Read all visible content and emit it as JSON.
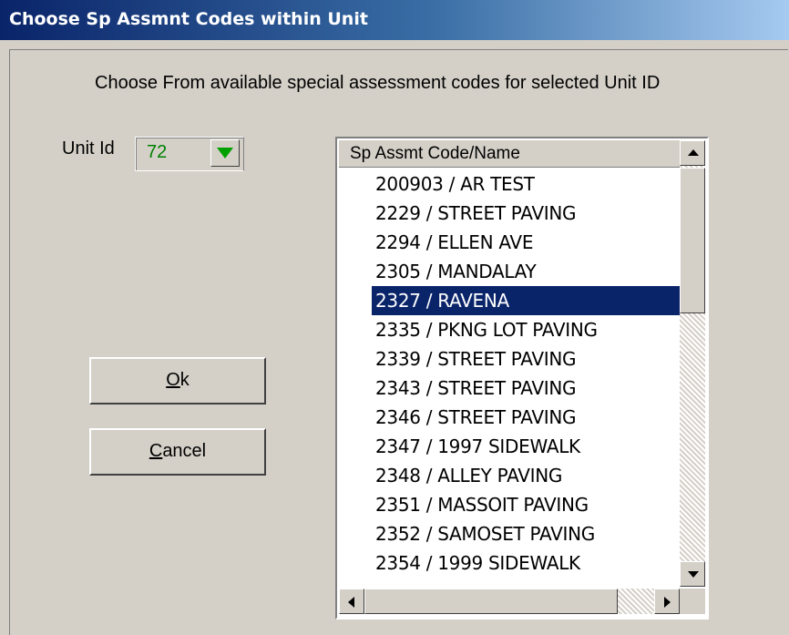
{
  "window": {
    "title": "Choose Sp Assmnt Codes within Unit"
  },
  "instruction": "Choose From available special assessment codes for selected Unit ID",
  "unit": {
    "label": "Unit Id",
    "value": "72"
  },
  "buttons": {
    "ok": {
      "mnemonic": "O",
      "rest": "k"
    },
    "cancel": {
      "mnemonic": "C",
      "rest": "ancel"
    }
  },
  "list": {
    "header": "Sp Assmt Code/Name",
    "selected_index": 4,
    "items": [
      "200903 / AR TEST",
      "2229 / STREET PAVING",
      "2294 / ELLEN AVE",
      "2305 / MANDALAY",
      "2327 / RAVENA",
      "2335 / PKNG LOT PAVING",
      "2339 / STREET PAVING",
      "2343 / STREET PAVING",
      "2346 / STREET PAVING",
      "2347 / 1997 SIDEWALK",
      "2348 / ALLEY PAVING",
      "2351 / MASSOIT PAVING",
      "2352 / SAMOSET PAVING",
      "2354 / 1999 SIDEWALK"
    ]
  },
  "colors": {
    "selection": "#0a246a",
    "unit_value": "#008000",
    "dropdown_arrow": "#00a000"
  },
  "icons": {
    "dropdown": "chevron-down-icon",
    "scroll_up": "arrow-up-icon",
    "scroll_down": "arrow-down-icon",
    "scroll_left": "arrow-left-icon",
    "scroll_right": "arrow-right-icon"
  }
}
